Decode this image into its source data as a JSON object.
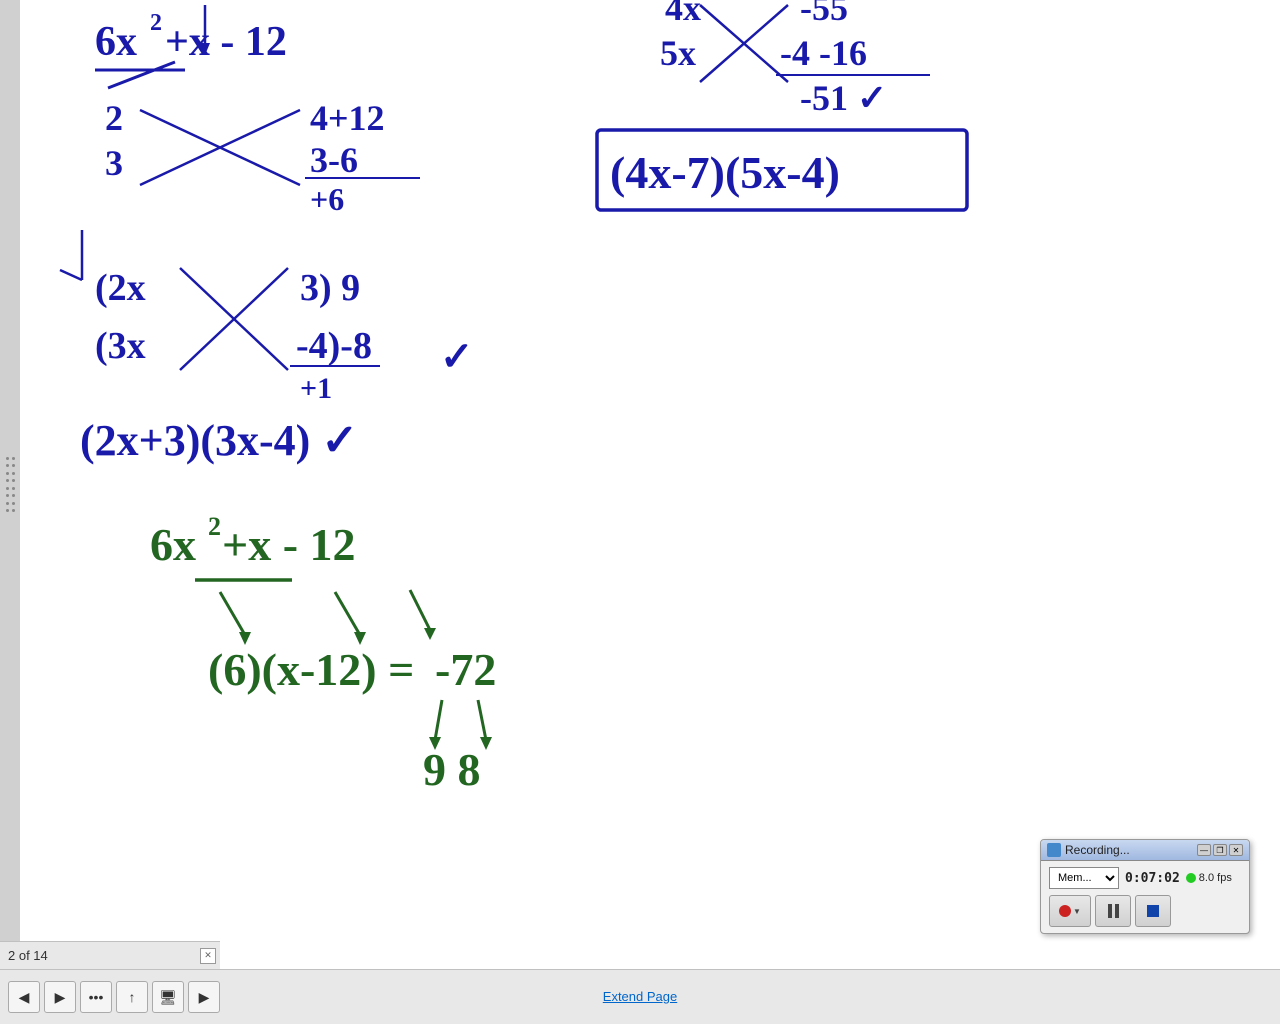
{
  "page": {
    "counter": "2 of 14",
    "extend_page": "Extend Page"
  },
  "toolbar": {
    "back_label": "◀",
    "forward_label": "▶",
    "more_label": "•••",
    "upload_label": "↑",
    "screen_label": "🖥",
    "right_label": "▶"
  },
  "recording": {
    "title": "Recording...",
    "dropdown_value": "Mem...",
    "time": "0:07:02",
    "fps": "8.0 fps",
    "minimize": "—",
    "restore": "❐",
    "close": "✕"
  }
}
